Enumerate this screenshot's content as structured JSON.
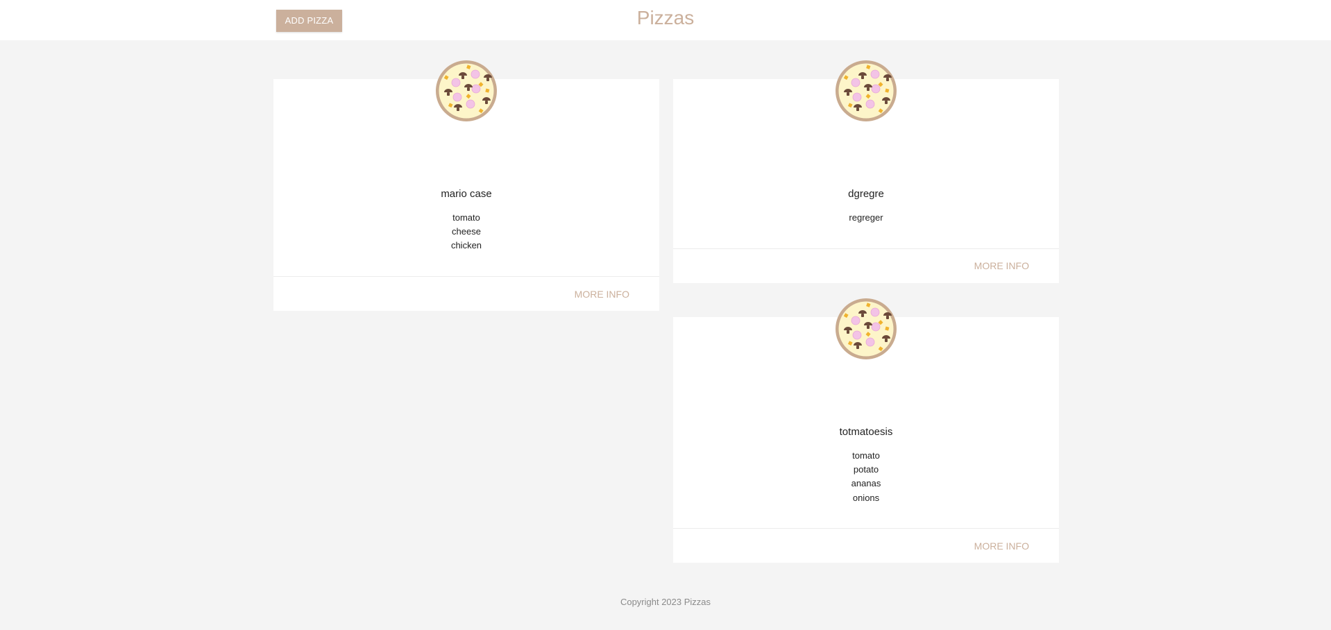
{
  "header": {
    "add_button_label": "ADD PIZZA",
    "title": "Pizzas"
  },
  "pizzas": [
    {
      "name": "mario case",
      "ingredients": [
        "tomato",
        "cheese",
        "chicken"
      ],
      "more_label": "MORE INFO"
    },
    {
      "name": "dgregre",
      "ingredients": [
        "regreger"
      ],
      "more_label": "MORE INFO"
    },
    {
      "name": "totmatoesis",
      "ingredients": [
        "tomato",
        "potato",
        "ananas",
        "onions"
      ],
      "more_label": "MORE INFO"
    }
  ],
  "footer": {
    "copyright": "Copyright 2023 Pizzas"
  },
  "colors": {
    "accent": "#cbb09c",
    "background": "#f4f4f4",
    "card": "#ffffff"
  }
}
